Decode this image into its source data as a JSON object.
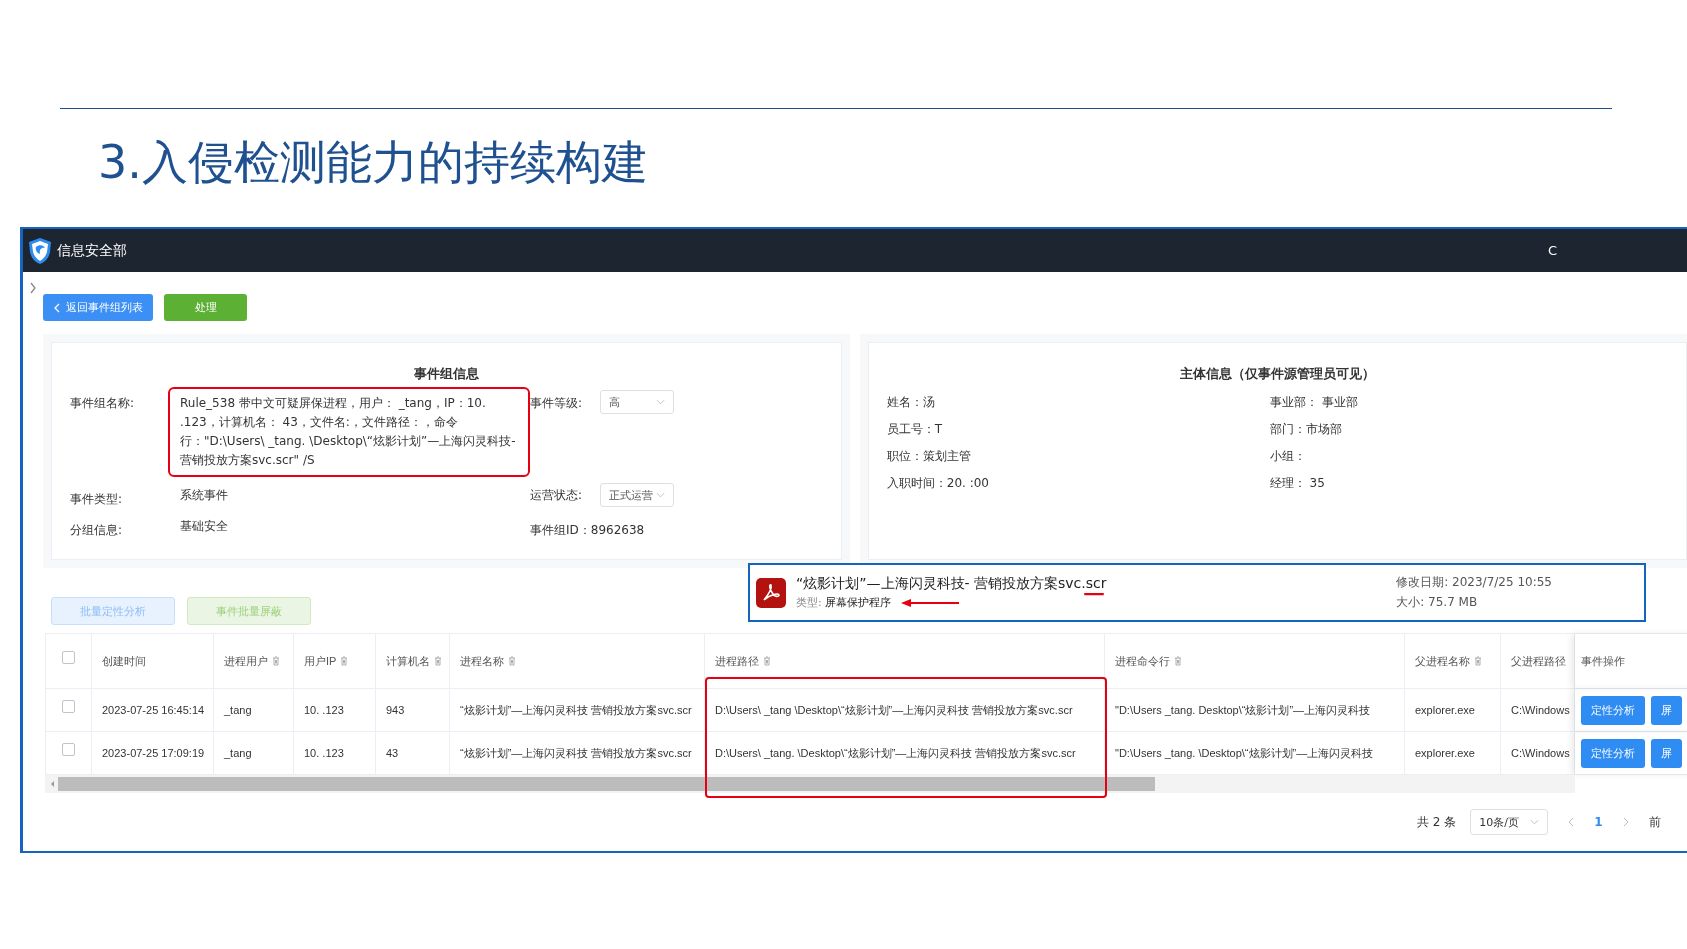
{
  "slide": {
    "title": "3.入侵检测能力的持续构建"
  },
  "app": {
    "title": "信息安全部",
    "top_right": "C"
  },
  "buttons": [
    {
      "label": "返回事件组列表",
      "kind": "back"
    },
    {
      "label": "处理",
      "kind": "success"
    }
  ],
  "event_group": {
    "heading": "事件组信息",
    "name": {
      "label": "事件组名称:",
      "value": "Rule_538       带中文可疑屏保进程，用户：       _tang，IP：10.        .123，计算机名：         43，文件名:，文件路径：，命令行：\"D:\\Users\\    _tang.     \\Desktop\\“炫影计划”—上海闪灵科技-     营销投放方案svc.scr\" /S",
      "highlighted": true
    },
    "level": {
      "label": "事件等级:",
      "value": "高"
    },
    "type": {
      "label": "事件类型:",
      "value": "系统事件"
    },
    "status": {
      "label": "运营状态:",
      "value": "正式运营"
    },
    "group": {
      "label": "分组信息:",
      "value": "基础安全"
    },
    "id": "事件组ID：8962638"
  },
  "subject": {
    "heading": "主体信息（仅事件源管理员可见）",
    "left": [
      "姓名：汤",
      "员工号：T",
      "职位：策划主管",
      "入职时间：20.            :00"
    ],
    "right": [
      "事业部：        事业部",
      "部门：市场部",
      "小组：",
      "经理：        35"
    ]
  },
  "file_popup": {
    "name": "“炫影计划”—上海闪灵科技-     营销投放方案svc.",
    "ext": "scr",
    "type_label": "类型:",
    "type_value": "屏幕保护程序",
    "modified": "修改日期: 2023/7/25 10:55",
    "size": "大小: 75.7 MB"
  },
  "batch_buttons": [
    {
      "label": "批量定性分析",
      "kind": "primary"
    },
    {
      "label": "事件批量屏蔽",
      "kind": "success"
    }
  ],
  "table": {
    "header_checked": false,
    "columns": [
      {
        "label": "创建时间",
        "filter": false
      },
      {
        "label": "进程用户",
        "filter": true
      },
      {
        "label": "用户IP",
        "filter": true
      },
      {
        "label": "计算机名",
        "filter": true
      },
      {
        "label": "进程名称",
        "filter": true
      },
      {
        "label": "进程路径",
        "filter": true
      },
      {
        "label": "进程命令行",
        "filter": true
      },
      {
        "label": "父进程名称",
        "filter": true
      },
      {
        "label": "父进程路径",
        "filter": false
      },
      {
        "label": "事件操作",
        "filter": false
      }
    ],
    "rows": [
      {
        "checked": false,
        "cells": [
          "2023-07-25 16:45:14",
          "_tang",
          "10.        .123",
          "943",
          "“炫影计划”—上海闪灵科技     营销投放方案svc.scr",
          "D:\\Users\\   _tang        \\Desktop\\“炫影计划”—上海闪灵科技        营销投放方案svc.scr",
          "\"D:\\Users    _tang.      Desktop\\“炫影计划”—上海闪灵科技",
          "explorer.exe",
          "C:\\Windows"
        ],
        "actions": [
          "定性分析",
          "屏"
        ]
      },
      {
        "checked": false,
        "cells": [
          "2023-07-25 17:09:19",
          "_tang",
          "10.        .123",
          "43",
          "“炫影计划”—上海闪灵科技     营销投放方案svc.scr",
          "D:\\Users\\   _tang.       \\Desktop\\“炫影计划”—上海闪灵科技        营销投放方案svc.scr",
          "\"D:\\Users    _tang.      \\Desktop\\“炫影计划”—上海闪灵科技",
          "explorer.exe",
          "C:\\Windows"
        ],
        "actions": [
          "定性分析",
          "屏"
        ]
      }
    ]
  },
  "pagination": {
    "total": "共 2 条",
    "page_size": "10条/页",
    "pages": [
      {
        "label": "1",
        "selected": true
      }
    ],
    "goto": "前"
  }
}
